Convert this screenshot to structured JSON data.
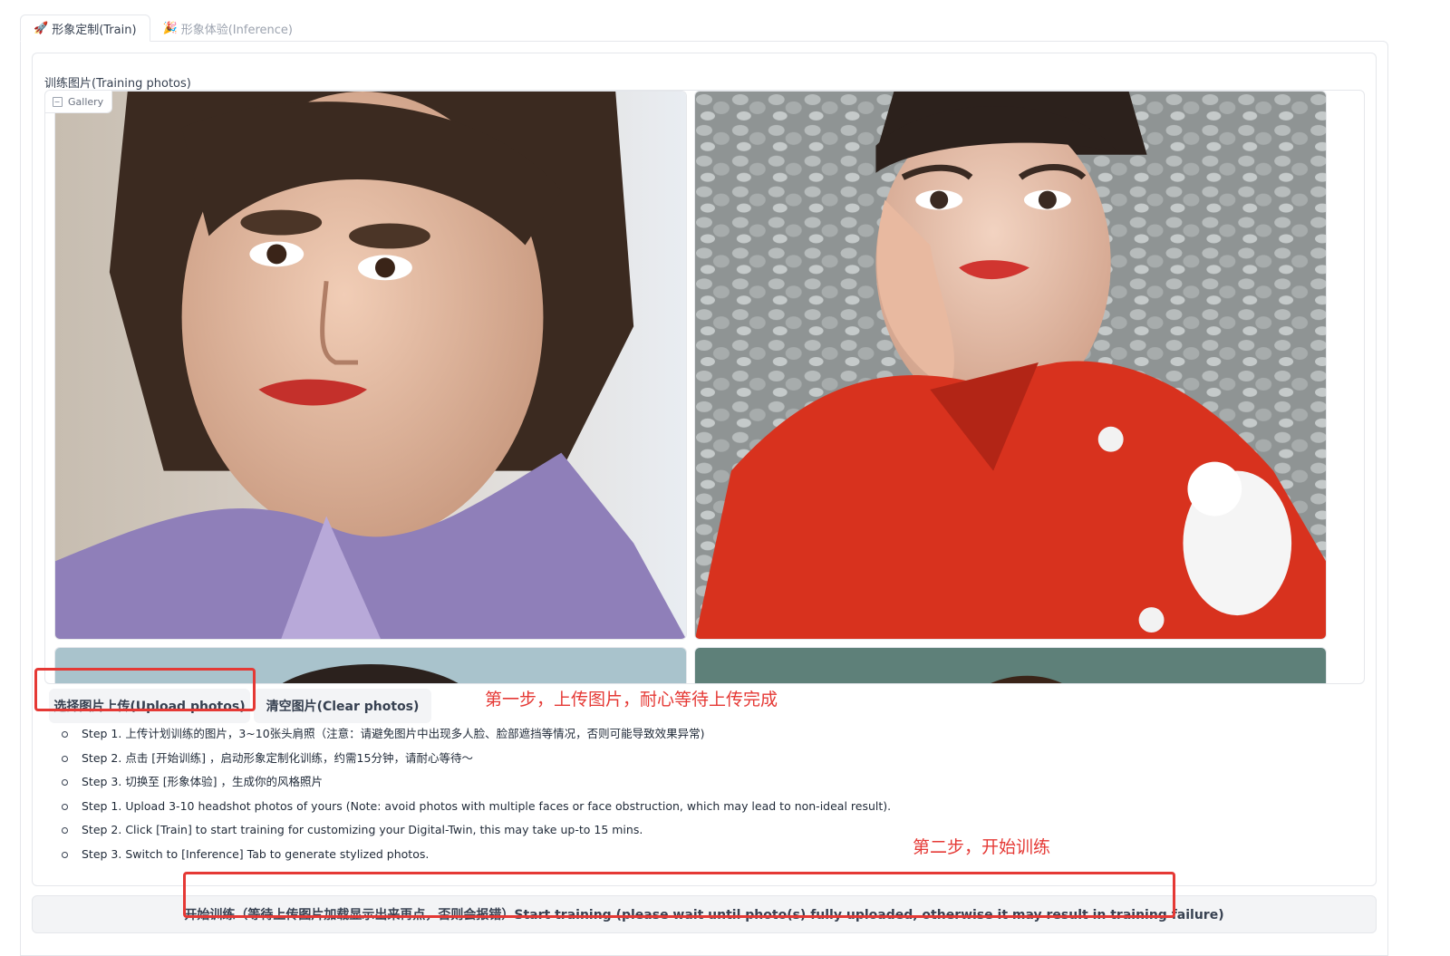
{
  "tabs": [
    {
      "icon": "🚀",
      "label": "形象定制(Train)",
      "active": true
    },
    {
      "icon": "🎉",
      "label": "形象体验(Inference)",
      "active": false
    }
  ],
  "training_block": {
    "label": "训练图片(Training photos)",
    "gallery_badge": "Gallery"
  },
  "buttons": {
    "upload": "选择图片上传(Upload photos)",
    "clear": "清空图片(Clear photos)",
    "train": "开始训练（等待上传图片加载显示出来再点，否则会报错）Start training (please wait until photo(s) fully uploaded, otherwise it may result in training failure)"
  },
  "annotations": {
    "step_one": "第一步，上传图片，耐心等待上传完成",
    "step_two": "第二步，开始训练"
  },
  "instructions": [
    "Step 1. 上传计划训练的图片，3~10张头肩照（注意：请避免图片中出现多人脸、脸部遮挡等情况，否则可能导致效果异常)",
    "Step 2. 点击 [开始训练] ，启动形象定制化训练，约需15分钟，请耐心等待～",
    "Step 3. 切换至 [形象体验] ，生成你的风格照片",
    "Step 1. Upload 3-10 headshot photos of yours (Note: avoid photos with multiple faces or face obstruction, which may lead to non-ideal result).",
    "Step 2. Click [Train] to start training for customizing your Digital-Twin, this may take up-to 15 mins.",
    "Step 3. Switch to [Inference] Tab to generate stylized photos."
  ],
  "colors": {
    "annotation_red": "#e53935",
    "button_bg": "#f3f4f6",
    "border": "#e5e7eb"
  }
}
